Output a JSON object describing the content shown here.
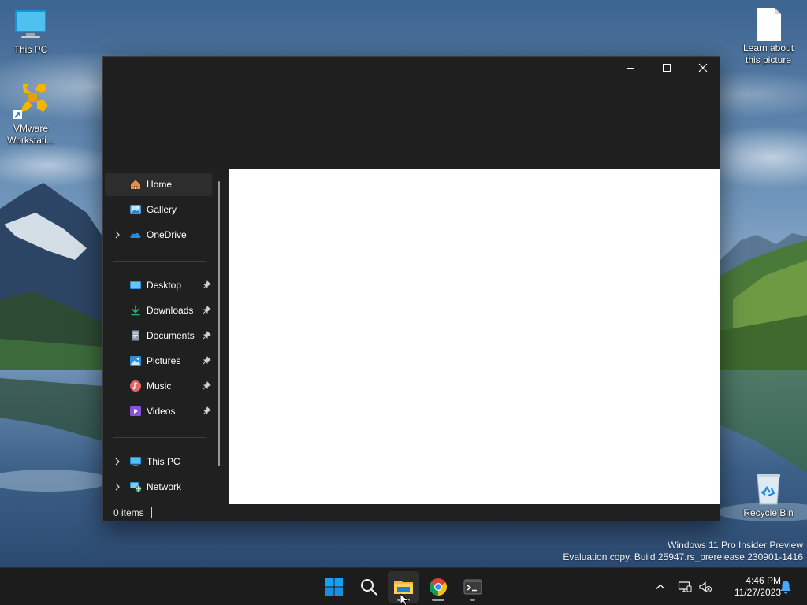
{
  "desktop": {
    "icons": [
      {
        "label": "This PC",
        "icon": "monitor-icon"
      },
      {
        "label": "VMware Workstati...",
        "icon": "vmware-icon"
      },
      {
        "label": "Learn about this picture",
        "icon": "document-icon"
      },
      {
        "label": "Recycle Bin",
        "icon": "recycle-bin-icon"
      }
    ]
  },
  "window": {
    "caption_buttons": [
      "minimize-icon",
      "maximize-icon",
      "close-icon"
    ],
    "nav": {
      "items": [
        {
          "label": "Home",
          "icon": "home-icon",
          "selected": true,
          "expandable": false,
          "pinned": false
        },
        {
          "label": "Gallery",
          "icon": "gallery-icon",
          "selected": false,
          "expandable": false,
          "pinned": false
        },
        {
          "label": "OneDrive",
          "icon": "onedrive-cloud-icon",
          "selected": false,
          "expandable": true,
          "pinned": false
        },
        {
          "label": "Desktop",
          "icon": "desktop-folder-icon",
          "selected": false,
          "expandable": false,
          "pinned": true
        },
        {
          "label": "Downloads",
          "icon": "downloads-icon",
          "selected": false,
          "expandable": false,
          "pinned": true
        },
        {
          "label": "Documents",
          "icon": "documents-icon",
          "selected": false,
          "expandable": false,
          "pinned": true
        },
        {
          "label": "Pictures",
          "icon": "pictures-icon",
          "selected": false,
          "expandable": false,
          "pinned": true
        },
        {
          "label": "Music",
          "icon": "music-icon",
          "selected": false,
          "expandable": false,
          "pinned": true
        },
        {
          "label": "Videos",
          "icon": "videos-icon",
          "selected": false,
          "expandable": false,
          "pinned": true
        },
        {
          "label": "This PC",
          "icon": "this-pc-icon",
          "selected": false,
          "expandable": true,
          "pinned": false
        },
        {
          "label": "Network",
          "icon": "network-icon",
          "selected": false,
          "expandable": true,
          "pinned": false
        }
      ]
    },
    "status": {
      "item_count": "0 items"
    }
  },
  "watermark": {
    "line1": "Windows 11 Pro Insider Preview",
    "line2": "Evaluation copy. Build 25947.rs_prerelease.230901-1416"
  },
  "taskbar": {
    "apps": [
      {
        "name": "start",
        "icon": "windows-start-icon"
      },
      {
        "name": "search",
        "icon": "search-icon"
      },
      {
        "name": "file-explorer",
        "icon": "file-explorer-icon",
        "active": true
      },
      {
        "name": "chrome",
        "icon": "chrome-icon"
      },
      {
        "name": "terminal",
        "icon": "terminal-icon"
      }
    ],
    "tray": {
      "icons": [
        "chevron-up-icon",
        "network-display-icon",
        "volume-muted-icon",
        "notification-bell-icon"
      ],
      "time": "4:46 PM",
      "date": "11/27/2023"
    }
  },
  "colors": {
    "window_bg": "#202020",
    "selected_bg": "#2d2d2d",
    "content_bg": "#ffffff",
    "taskbar_bg": "#1c1c1c",
    "accent": "#0078d4"
  }
}
